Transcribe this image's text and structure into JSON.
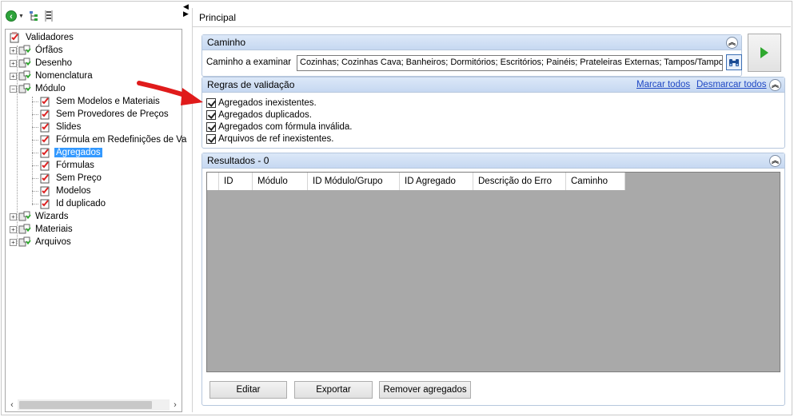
{
  "toolbar": {
    "back_icon": "green-back-arrow-icon",
    "tree_icon": "tree-structure-icon",
    "list_icon": "vertical-list-icon"
  },
  "tree": {
    "root": "Validadores",
    "items": [
      {
        "label": "Órfãos"
      },
      {
        "label": "Desenho"
      },
      {
        "label": "Nomenclatura"
      },
      {
        "label": "Módulo"
      }
    ],
    "modulo_children": [
      {
        "label": "Sem Modelos e Materiais"
      },
      {
        "label": "Sem Provedores de Preços"
      },
      {
        "label": "Slides"
      },
      {
        "label": "Fórmula em Redefinições de Va"
      },
      {
        "label": "Agregados"
      },
      {
        "label": "Fórmulas"
      },
      {
        "label": "Sem Preço"
      },
      {
        "label": "Modelos"
      },
      {
        "label": "Id duplicado"
      }
    ],
    "after_items": [
      {
        "label": "Wizards"
      },
      {
        "label": "Materiais"
      },
      {
        "label": "Arquivos"
      }
    ]
  },
  "main": {
    "tab_title": "Principal",
    "path_group": {
      "title": "Caminho",
      "label": "Caminho a examinar",
      "value": "Cozinhas; Cozinhas Cava; Banheiros; Dormitórios; Escritórios; Painéis; Prateleiras Externas; Tampos/Tamponamentos"
    },
    "rules_group": {
      "title": "Regras de validação",
      "select_all": "Marcar todos",
      "deselect_all": "Desmarcar todos",
      "rules": [
        {
          "label": "Agregados inexistentes.",
          "checked": true
        },
        {
          "label": "Agregados duplicados.",
          "checked": true
        },
        {
          "label": "Agregados com fórmula inválida.",
          "checked": true
        },
        {
          "label": "Arquivos de ref inexistentes.",
          "checked": true
        }
      ]
    },
    "results_group": {
      "title": "Resultados - 0",
      "columns": [
        "ID",
        "Módulo",
        "ID Módulo/Grupo",
        "ID Agregado",
        "Descrição do Erro",
        "Caminho"
      ]
    },
    "buttons": {
      "edit": "Editar",
      "export": "Exportar",
      "remove": "Remover agregados"
    }
  },
  "colors": {
    "selection": "#3399ff",
    "link": "#1f48c4",
    "group_header": "#c6d8f1",
    "grid_bg": "#a9a9a9",
    "annotation_arrow": "#e01b1b"
  }
}
